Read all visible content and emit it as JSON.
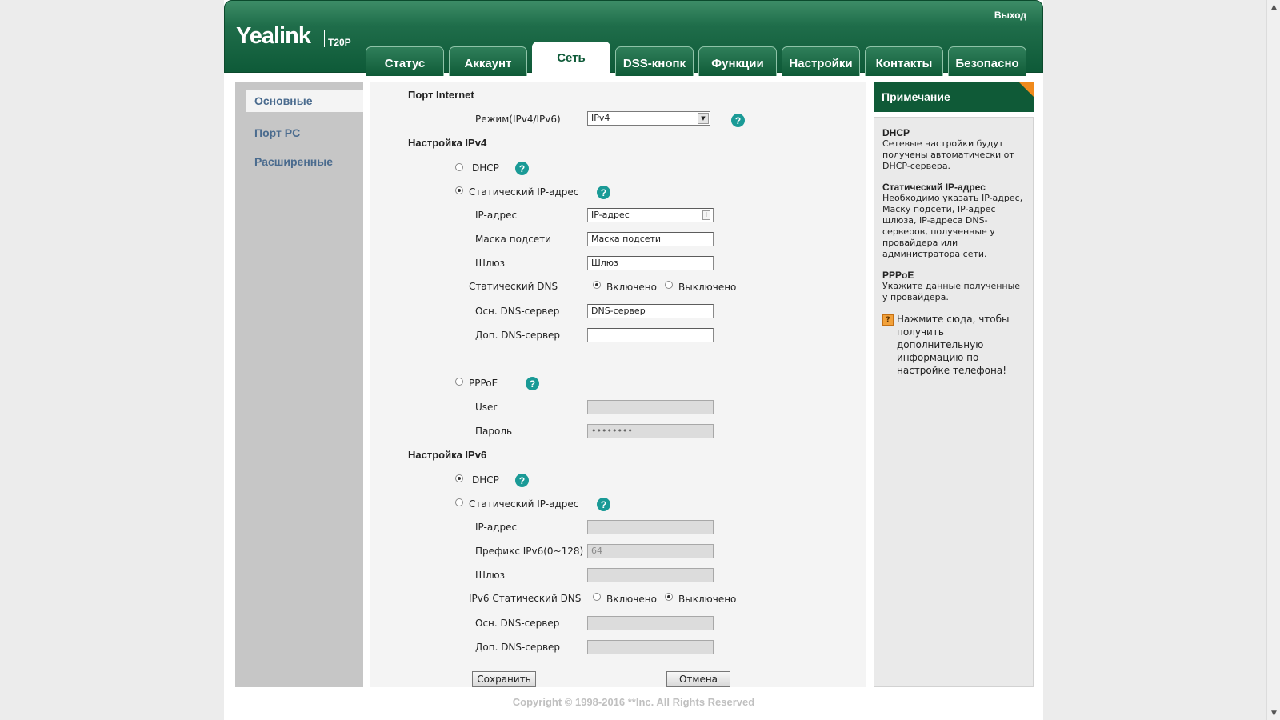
{
  "header": {
    "logo": "Yealink",
    "model": "T20P",
    "logout": "Выход",
    "tabs": [
      "Статус",
      "Аккаунт",
      "Сеть",
      "DSS-кнопк",
      "Функции",
      "Настройки",
      "Контакты",
      "Безопасно"
    ],
    "active_tab": "Сеть"
  },
  "sidebar": {
    "items": [
      "Основные",
      "Порт PC",
      "Расширенные"
    ],
    "active_item": "Основные"
  },
  "form": {
    "internet_port_title": "Порт Internet",
    "mode_label": "Режим(IPv4/IPv6)",
    "mode_value": "IPv4",
    "ipv4_title": "Настройка IPv4",
    "ipv4": {
      "dhcp_label": "DHCP",
      "dhcp_selected": false,
      "static_label": "Статический IP-адрес",
      "static_selected": true,
      "ip_label": "IP-адрес",
      "ip_value": "IP-адрес",
      "mask_label": "Маска подсети",
      "mask_value": "Маска подсети",
      "gateway_label": "Шлюз",
      "gateway_value": "Шлюз",
      "static_dns_label": "Статический DNS",
      "on_label": "Включено",
      "off_label": "Выключено",
      "static_dns_on": true,
      "primary_dns_label": "Осн. DNS-сервер",
      "primary_dns_value": "DNS-сервер",
      "secondary_dns_label": "Доп. DNS-сервер",
      "secondary_dns_value": "",
      "pppoe_label": "PPPoE",
      "pppoe_selected": false,
      "user_label": "User",
      "user_value": "",
      "password_label": "Пароль",
      "password_value": "••••••••"
    },
    "ipv6_title": "Настройка IPv6",
    "ipv6": {
      "dhcp_label": "DHCP",
      "dhcp_selected": true,
      "static_label": "Статический IP-адрес",
      "static_selected": false,
      "ip_label": "IP-адрес",
      "ip_value": "",
      "prefix_label": "Префикс IPv6(0~128)",
      "prefix_value": "64",
      "gateway_label": "Шлюз",
      "gateway_value": "",
      "static_dns_label": "IPv6 Статический DNS",
      "on_label": "Включено",
      "off_label": "Выключено",
      "static_dns_on": false,
      "primary_dns_label": "Осн. DNS-сервер",
      "primary_dns_value": "",
      "secondary_dns_label": "Доп. DNS-сервер",
      "secondary_dns_value": ""
    },
    "save_label": "Сохранить",
    "cancel_label": "Отмена"
  },
  "note": {
    "title": "Примечание",
    "sections": [
      {
        "heading": "DHCP",
        "text": "Сетевые настройки будут получены автоматически от DHCP-сервера."
      },
      {
        "heading": "Статический IP-адрес",
        "text": "Необходимо указать IP-адрес, Маску подсети, IP-адрес шлюза, IP-адреса DNS-серверов, полученные у провайдера или администратора сети."
      },
      {
        "heading": "PPPoE",
        "text": "Укажите данные полученные у провайдера."
      }
    ],
    "link_text": "Нажмите сюда, чтобы получить дополнительную информацию по настройке телефона!"
  },
  "footer": {
    "copyright": "Copyright © 1998-2016 **Inc. All Rights Reserved"
  },
  "colors": {
    "brand_green": "#0e5a38",
    "accent_orange": "#f08a1c",
    "help_teal": "#1a9a96",
    "sidebar_link": "#4a6b8e"
  }
}
